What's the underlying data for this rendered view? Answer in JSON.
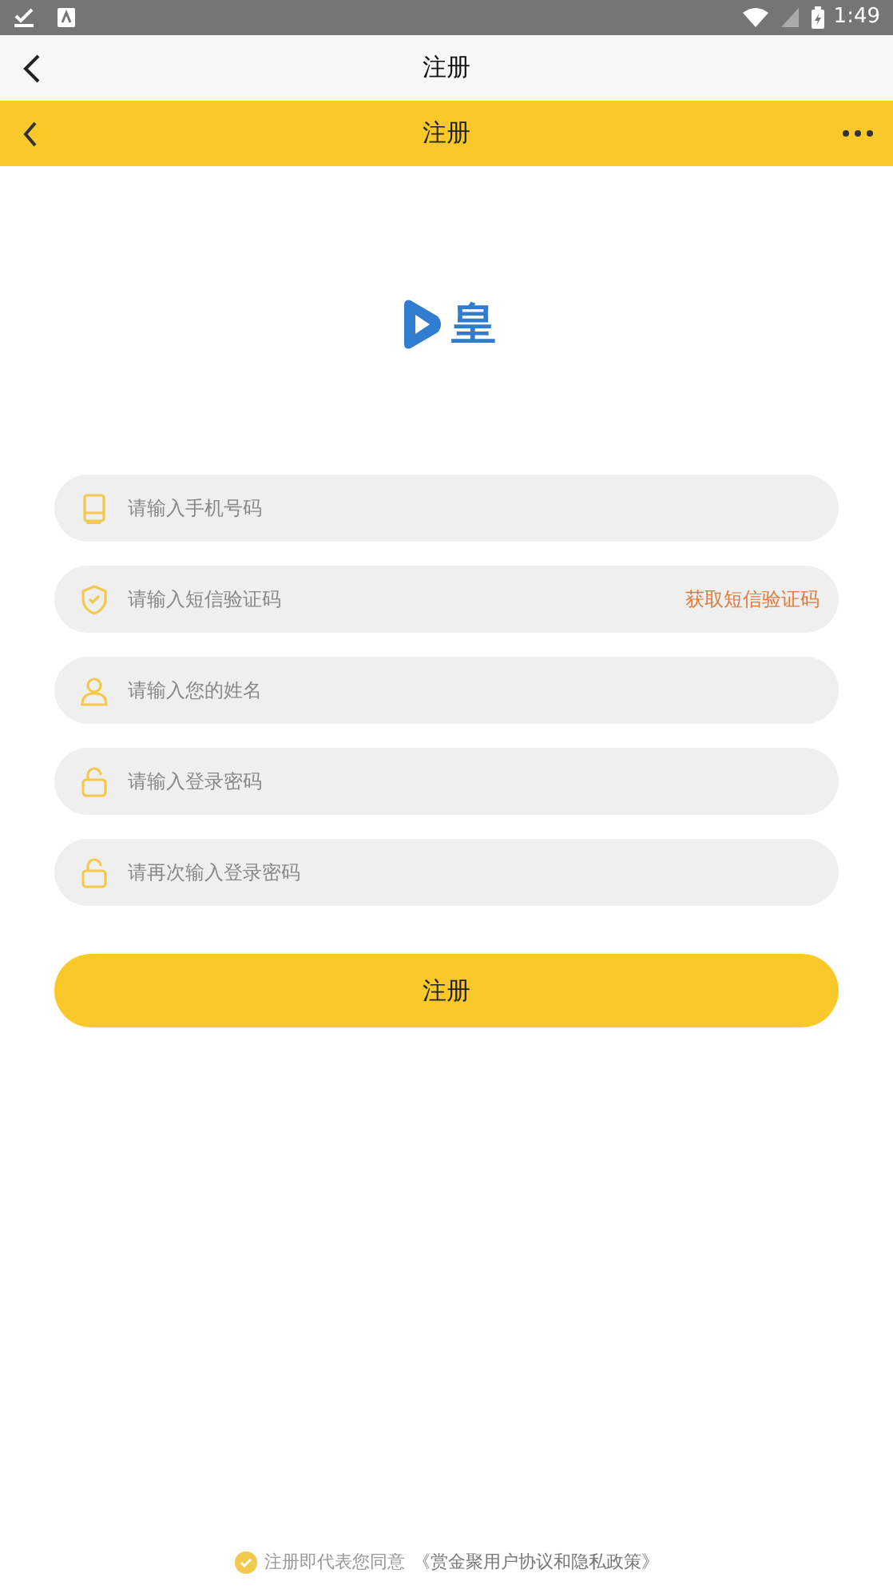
{
  "status_bar": {
    "time": "1:49"
  },
  "system_bar": {
    "title": "注册"
  },
  "app_bar": {
    "title": "注册"
  },
  "logo": {
    "text": "皇"
  },
  "fields": [
    {
      "kind": "phone",
      "placeholder": "请输入手机号码"
    },
    {
      "kind": "code",
      "placeholder": "请输入短信验证码",
      "action": "获取短信验证码"
    },
    {
      "kind": "name",
      "placeholder": "请输入您的姓名"
    },
    {
      "kind": "password",
      "placeholder": "请输入登录密码"
    },
    {
      "kind": "password",
      "placeholder": "请再次输入登录密码"
    }
  ],
  "submit": {
    "label": "注册"
  },
  "agreement": {
    "checked": true,
    "text": "注册即代表您同意",
    "link": "《赏金聚用户协议和隐私政策》"
  }
}
